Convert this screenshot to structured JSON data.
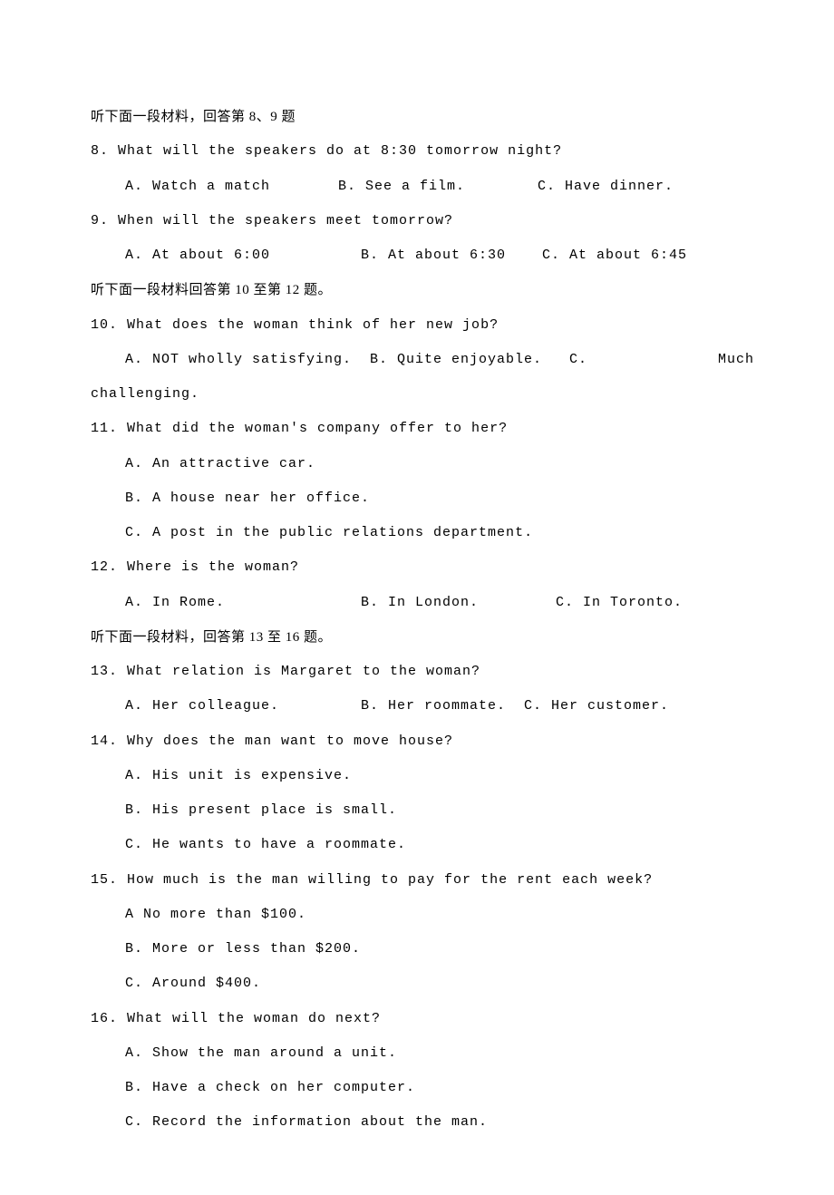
{
  "sec1": {
    "heading": "听下面一段材料，回答第 8、9 题",
    "q8": {
      "stem": "8. What will the speakers do at 8:30 tomorrow night?",
      "a": "A. Watch a match",
      "b": "B. See a film.",
      "c": "C. Have dinner."
    },
    "q9": {
      "stem": "9. When will the speakers meet tomorrow?",
      "a": "A. At about 6:00",
      "b": "B. At about 6:30",
      "c": "C. At about 6:45"
    }
  },
  "sec2": {
    "heading": "听下面一段材料回答第 10 至第 12 题。",
    "q10": {
      "stem": "10. What does the woman think of her new job?",
      "a": "A. NOT wholly satisfying.",
      "b": "B. Quite enjoyable.",
      "c": "C.",
      "c_tail": "Much",
      "stem_tail": "challenging."
    },
    "q11": {
      "stem": "11. What did the woman's company offer to her?",
      "a": "A. An attractive car.",
      "b": "B. A house near her office.",
      "c": "C. A post in the public relations department."
    },
    "q12": {
      "stem": "12. Where is the woman?",
      "a": "A. In Rome.",
      "b": "B. In London.",
      "c": "C. In Toronto."
    }
  },
  "sec3": {
    "heading": "听下面一段材料，回答第 13 至 16 题。",
    "q13": {
      "stem": "13. What relation is Margaret to the woman?",
      "a": "A. Her colleague.",
      "b": "B. Her roommate.",
      "c": "C. Her customer."
    },
    "q14": {
      "stem": "14. Why does the man want to move house?",
      "a": "A. His unit is expensive.",
      "b": "B. His present place is small.",
      "c": "C. He wants to have a roommate."
    },
    "q15": {
      "stem": "15. How much is the man willing to pay for the rent each week?",
      "a": "A  No more than $100.",
      "b": "B. More or less than $200.",
      "c": "C. Around $400."
    },
    "q16": {
      "stem": "16. What will the woman do next?",
      "a": "A. Show the man around a unit.",
      "b": "B. Have a check on her computer.",
      "c": "C. Record the information about the man."
    }
  }
}
